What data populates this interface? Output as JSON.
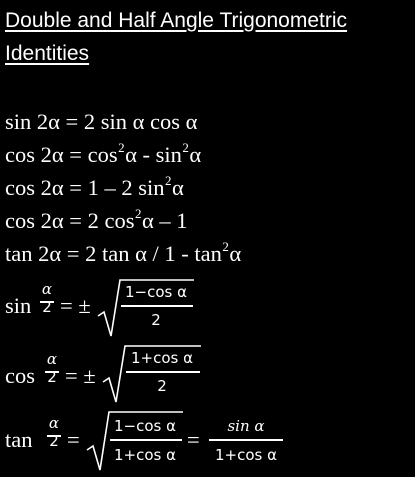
{
  "title": {
    "line1": "Double and Half Angle Trigonometric",
    "line2": "Identities"
  },
  "identities": [
    {
      "text_before": "sin 2α = 2 sin α cos α"
    },
    {
      "text_before": "cos 2α = cos",
      "sup1": "2",
      "mid": "α - sin",
      "sup2": "2",
      "after": "α"
    },
    {
      "text_before": "cos 2α = 1 – 2 sin",
      "sup1": "2",
      "after": "α"
    },
    {
      "text_before": "cos 2α = 2 cos",
      "sup1": "2",
      "after": "α – 1"
    },
    {
      "text_before": "tan 2α = 2 tan α / 1 - tan",
      "sup1": "2",
      "after": "α"
    }
  ],
  "half_angle": {
    "sin": {
      "fn": "sin",
      "frac_num": "α",
      "frac_den": "2",
      "relation": "= ±",
      "rad_num": "1−cos α",
      "rad_den": "2"
    },
    "cos": {
      "fn": "cos",
      "frac_num": "α",
      "frac_den": "2",
      "relation": "= ±",
      "rad_num": "1+cos α",
      "rad_den": "2"
    },
    "tan": {
      "fn": "tan",
      "frac_num": "α",
      "frac_den": "2",
      "relation": "=",
      "rad_num": "1−cos α",
      "rad_den": "1+cos α",
      "relation2": "=",
      "rhs_num": "sin α",
      "rhs_den": "1+cos α"
    }
  }
}
